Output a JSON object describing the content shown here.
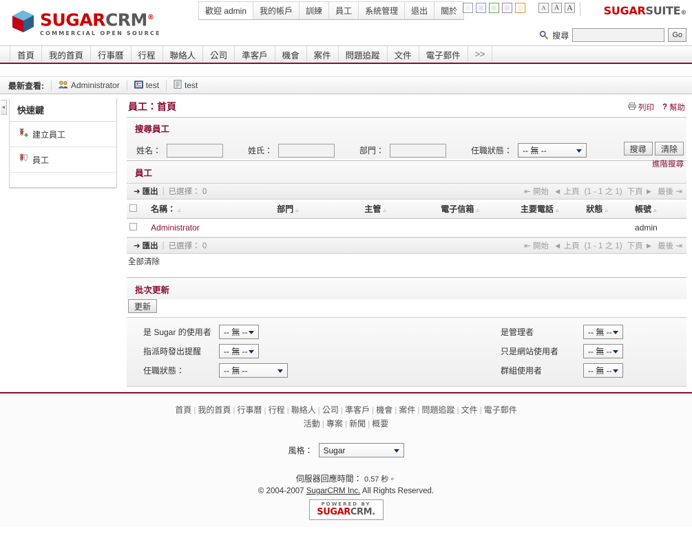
{
  "brand": {
    "logo_sugar": "SUGAR",
    "logo_crm": "CRM",
    "logo_reg": "®",
    "tagline": "COMMERCIAL OPEN SOURCE",
    "suite_a": "SUGAR",
    "suite_b": "SUITE",
    "suite_reg": "®"
  },
  "utility_tabs": [
    {
      "label": "歡迎 admin",
      "name": "welcome-admin"
    },
    {
      "label": "我的帳戶",
      "name": "my-account"
    },
    {
      "label": "訓練",
      "name": "training"
    },
    {
      "label": "員工",
      "name": "employees"
    },
    {
      "label": "系統管理",
      "name": "admin"
    },
    {
      "label": "退出",
      "name": "logout"
    },
    {
      "label": "關於",
      "name": "about"
    }
  ],
  "theme_swatches": [
    {
      "name": "swatch-gray",
      "color": "#f0f0f0",
      "border": "#9a9a9a"
    },
    {
      "name": "swatch-blue",
      "color": "#e4e6f5",
      "border": "#8c92c8"
    },
    {
      "name": "swatch-green",
      "color": "#e6f0e0",
      "border": "#6fa54a"
    },
    {
      "name": "swatch-purple",
      "color": "#ece4f3",
      "border": "#9c7bc0"
    },
    {
      "name": "swatch-orange",
      "color": "#fbf0dc",
      "border": "#d9962a"
    }
  ],
  "font_sizes": [
    {
      "label": "A",
      "name": "font-small"
    },
    {
      "label": "A",
      "name": "font-medium"
    },
    {
      "label": "A",
      "name": "font-large"
    }
  ],
  "search": {
    "label": "搜尋",
    "value": "",
    "placeholder": "",
    "go_label": "Go"
  },
  "module_tabs": [
    {
      "label": "首頁"
    },
    {
      "label": "我的首頁"
    },
    {
      "label": "行事曆"
    },
    {
      "label": "行程"
    },
    {
      "label": "聯絡人"
    },
    {
      "label": "公司"
    },
    {
      "label": "準客戶"
    },
    {
      "label": "機會"
    },
    {
      "label": "案件"
    },
    {
      "label": "問題追蹤"
    },
    {
      "label": "文件"
    },
    {
      "label": "電子郵件"
    },
    {
      "label": ">>"
    }
  ],
  "last_viewed": {
    "title": "最新查看:",
    "items": [
      {
        "label": "Administrator",
        "icon": "users-icon"
      },
      {
        "label": "test",
        "icon": "contact-icon"
      },
      {
        "label": "test",
        "icon": "document-icon"
      }
    ]
  },
  "sidebar": {
    "heading": "快速鍵",
    "items": [
      {
        "label": "建立員工",
        "icon": "create-employee-icon"
      },
      {
        "label": "員工",
        "icon": "employee-icon"
      }
    ]
  },
  "page": {
    "title": "員工：首頁",
    "print_label": "列印",
    "help_label": "幫助"
  },
  "search_panel": {
    "heading": "搜尋員工",
    "fields": [
      {
        "label": "姓名：",
        "value": "",
        "name": "first-name-input"
      },
      {
        "label": "姓氏：",
        "value": "",
        "name": "last-name-input"
      },
      {
        "label": "部門：",
        "value": "",
        "name": "department-input"
      }
    ],
    "status": {
      "label": "任職狀態：",
      "value": "-- 無 --"
    },
    "search_button": "搜尋",
    "clear_button": "清除",
    "advanced_link": "進階搜尋"
  },
  "list": {
    "heading": "員工",
    "export_label": "匯出",
    "selected_label": "已選擇：",
    "selected_count": "0",
    "pager": {
      "start": "開始",
      "prev": "上頁",
      "range": "(1 - 1 之 1)",
      "next": "下頁",
      "last": "最後"
    },
    "columns": [
      {
        "label": "名稱："
      },
      {
        "label": "部門"
      },
      {
        "label": "主管"
      },
      {
        "label": "電子信箱"
      },
      {
        "label": "主要電話"
      },
      {
        "label": "狀態"
      },
      {
        "label": "帳號"
      }
    ],
    "rows": [
      {
        "name": "Administrator",
        "department": "",
        "supervisor": "",
        "email": "",
        "phone": "",
        "status": "",
        "username": "admin"
      }
    ],
    "clear_all": "全部清除"
  },
  "mass_update": {
    "heading": "批次更新",
    "update_button": "更新",
    "left_fields": [
      {
        "label": "是 Sugar 的使用者",
        "value": "-- 無 --",
        "name": "is-sugar-user-select"
      },
      {
        "label": "指派時發出提醒",
        "value": "-- 無 --",
        "name": "notify-on-assignment-select"
      },
      {
        "label": "任職狀態：",
        "value": "-- 無 --",
        "name": "employment-status-select"
      }
    ],
    "right_fields": [
      {
        "label": "是管理者",
        "value": "-- 無 --",
        "name": "is-administrator-select"
      },
      {
        "label": "只是網站使用者",
        "value": "-- 無 --",
        "name": "portal-only-user-select"
      },
      {
        "label": "群組使用者",
        "value": "-- 無 --",
        "name": "group-user-select"
      }
    ]
  },
  "footer": {
    "links_row1": [
      "首頁",
      "我的首頁",
      "行事曆",
      "行程",
      "聯絡人",
      "公司",
      "準客戶",
      "機會",
      "案件",
      "問題追蹤",
      "文件",
      "電子郵件"
    ],
    "links_row2": [
      "活動",
      "專案",
      "新聞",
      "概要"
    ],
    "theme_label": "風格：",
    "theme_value": "Sugar",
    "response_label": "伺服器回應時間：",
    "response_value": "0.57 秒。",
    "copyright_prefix": "© 2004-2007 ",
    "copyright_link": "SugarCRM Inc.",
    "copyright_suffix": " All Rights Reserved.",
    "powered_by": "POWERED BY",
    "powered_sugar": "SUGAR",
    "powered_crm": "CRM."
  },
  "colors": {
    "brand_red": "#cc0000",
    "accent_maroon": "#8b0d2e",
    "gray_text": "#58595b"
  }
}
